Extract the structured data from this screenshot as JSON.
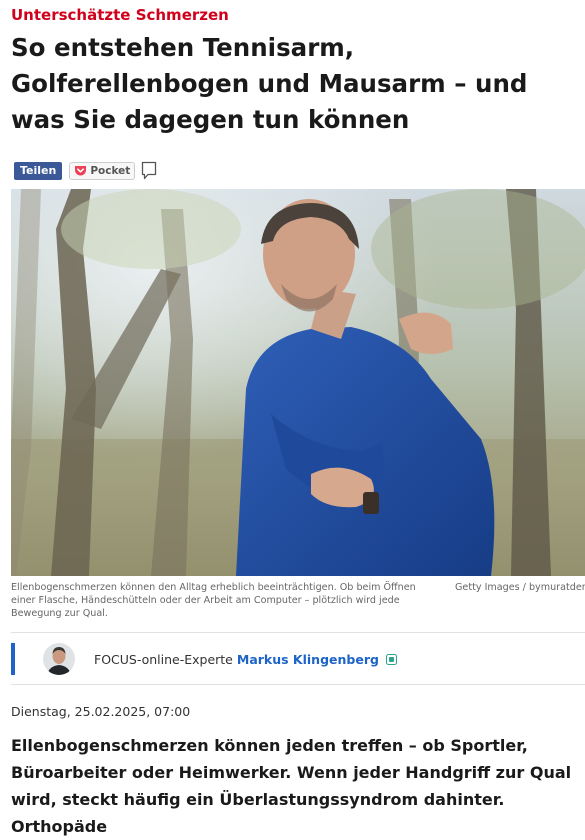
{
  "article": {
    "kicker": "Unterschätzte Schmerzen",
    "headline": "So entstehen Tennisarm, Golferellenbogen und Mausarm – und was Sie dagegen tun können",
    "share": {
      "share_label": "Teilen",
      "pocket_label": "Pocket"
    },
    "image": {
      "description_icon": "photo-man-holding-elbow",
      "caption": "Ellenbogenschmerzen können den Alltag erheblich beeinträchtigen. Ob beim Öffnen einer Flasche, Händeschütteln oder der Arbeit am Computer – plötzlich wird jede Bewegung zur Qual.",
      "credit": "Getty Images / bymuratden"
    },
    "author": {
      "prefix": "FOCUS-online-Experte",
      "name": "Markus Klingenberg"
    },
    "date": "Dienstag, 25.02.2025, 07:00",
    "lead": "Ellenbogenschmerzen können jeden treffen – ob Sportler, Büroarbeiter oder Heimwerker. Wenn jeder Handgriff zur Qual wird, steckt häufig ein Überlastungssyndrom dahinter. Orthopäde"
  },
  "colors": {
    "kicker": "#d0021b",
    "share_button": "#3b5998",
    "author_accent": "#1e64c8"
  }
}
